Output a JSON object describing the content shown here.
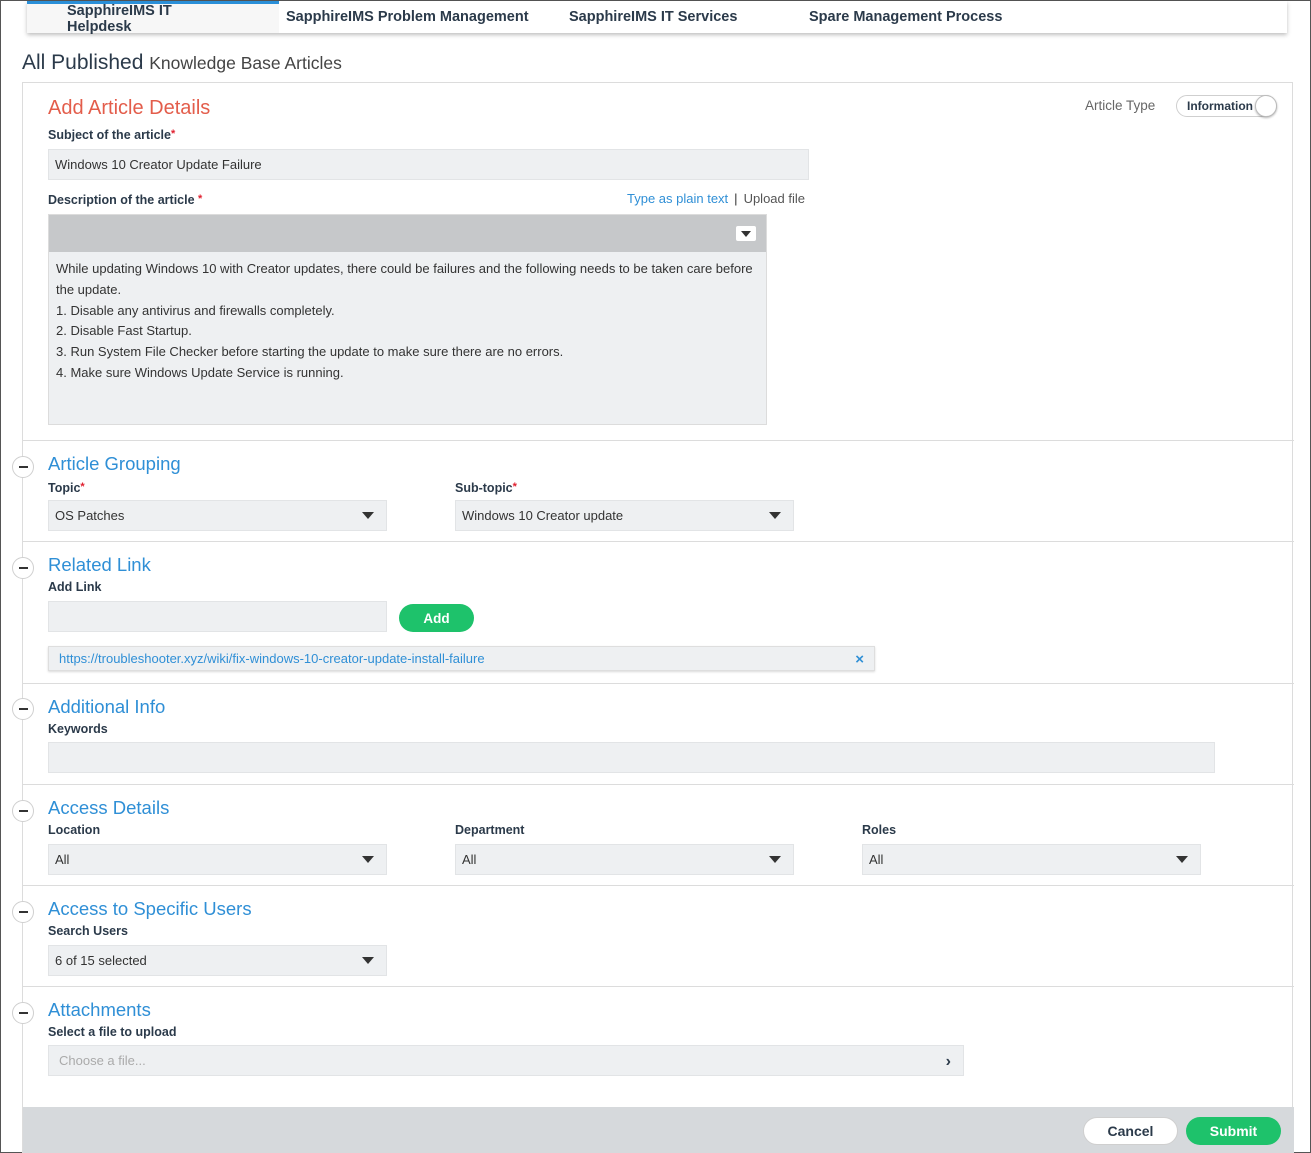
{
  "tabs": [
    {
      "label": "SapphireIMS IT Helpdesk",
      "active": true
    },
    {
      "label": "SapphireIMS Problem Management"
    },
    {
      "label": "SapphireIMS IT Services"
    },
    {
      "label": "Spare Management Process"
    }
  ],
  "page": {
    "title": "All Published",
    "subtitle": "Knowledge Base Articles"
  },
  "article_details": {
    "title": "Add Article Details",
    "article_type_label": "Article Type",
    "article_type_value": "Information",
    "subject_label": "Subject of the article",
    "subject_value": "Windows 10 Creator Update Failure",
    "description_label": "Description of the article",
    "plain_text_link": "Type as plain text",
    "separator": "|",
    "upload_file_link": "Upload file",
    "description_lines": [
      "While updating Windows 10 with Creator updates, there could be failures and the following needs to be taken care before the update.",
      "1. Disable any antivirus and firewalls completely.",
      "2. Disable Fast Startup.",
      "3. Run System File Checker before starting the update to make sure there are no errors.",
      "4. Make sure Windows Update Service is running."
    ]
  },
  "required_mark": "*",
  "grouping": {
    "title": "Article Grouping",
    "topic_label": "Topic",
    "topic_value": "OS Patches",
    "subtopic_label": "Sub-topic",
    "subtopic_value": "Windows 10 Creator update"
  },
  "related_link": {
    "title": "Related Link",
    "add_link_label": "Add Link",
    "add_link_value": "",
    "add_button": "Add",
    "links": [
      "https://troubleshooter.xyz/wiki/fix-windows-10-creator-update-install-failure"
    ],
    "remove_icon": "×"
  },
  "additional_info": {
    "title": "Additional Info",
    "keywords_label": "Keywords",
    "keywords_value": ""
  },
  "access_details": {
    "title": "Access Details",
    "location_label": "Location",
    "location_value": "All",
    "department_label": "Department",
    "department_value": "All",
    "roles_label": "Roles",
    "roles_value": "All"
  },
  "specific_users": {
    "title": "Access to Specific Users",
    "search_label": "Search Users",
    "search_value": "6 of 15 selected"
  },
  "attachments": {
    "title": "Attachments",
    "select_label": "Select a file to upload",
    "file_placeholder": "Choose a file...",
    "chevron": "›"
  },
  "footer": {
    "cancel": "Cancel",
    "submit": "Submit"
  },
  "colors": {
    "accent": "#2f8fd6",
    "heading_red": "#e35d4b",
    "green": "#1ec26b"
  },
  "icons": {
    "collapse": "minus-icon",
    "dropdown": "caret-down-icon",
    "remove": "close-icon",
    "file": "chevron-right-icon"
  }
}
